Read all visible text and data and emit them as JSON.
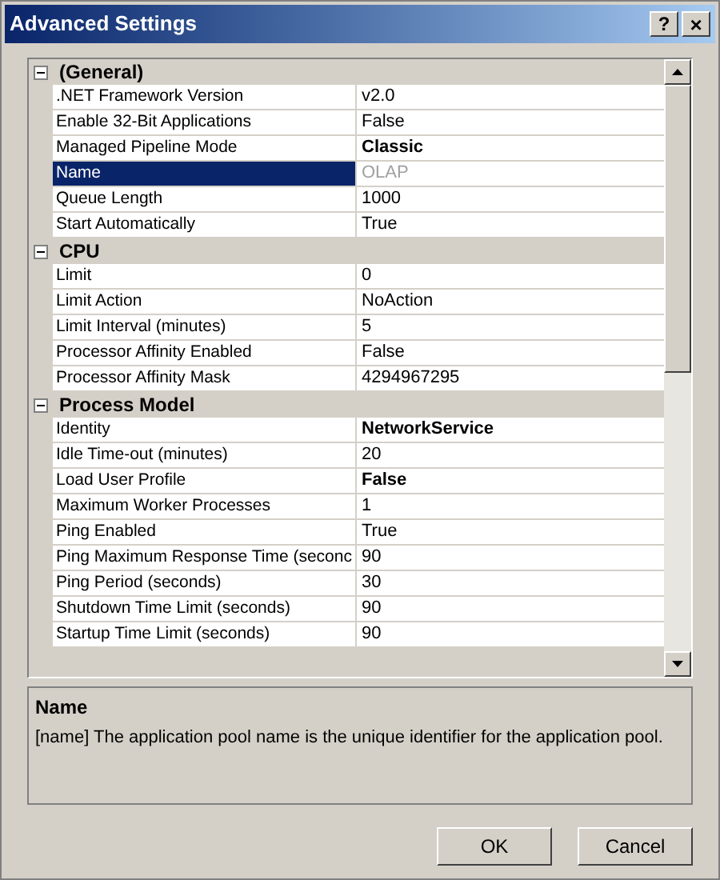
{
  "window": {
    "title": "Advanced Settings",
    "help_button": "?",
    "close_button": "×"
  },
  "groups": [
    {
      "name": "(General)",
      "expanded": true,
      "properties": [
        {
          "name": ".NET Framework Version",
          "value": "v2.0",
          "bold": false,
          "selected": false,
          "disabled": false
        },
        {
          "name": "Enable 32-Bit Applications",
          "value": "False",
          "bold": false,
          "selected": false,
          "disabled": false
        },
        {
          "name": "Managed Pipeline Mode",
          "value": "Classic",
          "bold": true,
          "selected": false,
          "disabled": false
        },
        {
          "name": "Name",
          "value": "OLAP",
          "bold": false,
          "selected": true,
          "disabled": true
        },
        {
          "name": "Queue Length",
          "value": "1000",
          "bold": false,
          "selected": false,
          "disabled": false
        },
        {
          "name": "Start Automatically",
          "value": "True",
          "bold": false,
          "selected": false,
          "disabled": false
        }
      ]
    },
    {
      "name": "CPU",
      "expanded": true,
      "properties": [
        {
          "name": "Limit",
          "value": "0",
          "bold": false,
          "selected": false,
          "disabled": false
        },
        {
          "name": "Limit Action",
          "value": "NoAction",
          "bold": false,
          "selected": false,
          "disabled": false
        },
        {
          "name": "Limit Interval (minutes)",
          "value": "5",
          "bold": false,
          "selected": false,
          "disabled": false
        },
        {
          "name": "Processor Affinity Enabled",
          "value": "False",
          "bold": false,
          "selected": false,
          "disabled": false
        },
        {
          "name": "Processor Affinity Mask",
          "value": "4294967295",
          "bold": false,
          "selected": false,
          "disabled": false
        }
      ]
    },
    {
      "name": "Process Model",
      "expanded": true,
      "properties": [
        {
          "name": "Identity",
          "value": "NetworkService",
          "bold": true,
          "selected": false,
          "disabled": false
        },
        {
          "name": "Idle Time-out (minutes)",
          "value": "20",
          "bold": false,
          "selected": false,
          "disabled": false
        },
        {
          "name": "Load User Profile",
          "value": "False",
          "bold": true,
          "selected": false,
          "disabled": false
        },
        {
          "name": "Maximum Worker Processes",
          "value": "1",
          "bold": false,
          "selected": false,
          "disabled": false
        },
        {
          "name": "Ping Enabled",
          "value": "True",
          "bold": false,
          "selected": false,
          "disabled": false
        },
        {
          "name": "Ping Maximum Response Time (seconc",
          "value": "90",
          "bold": false,
          "selected": false,
          "disabled": false
        },
        {
          "name": "Ping Period (seconds)",
          "value": "30",
          "bold": false,
          "selected": false,
          "disabled": false
        },
        {
          "name": "Shutdown Time Limit (seconds)",
          "value": "90",
          "bold": false,
          "selected": false,
          "disabled": false
        },
        {
          "name": "Startup Time Limit (seconds)",
          "value": "90",
          "bold": false,
          "selected": false,
          "disabled": false
        }
      ]
    }
  ],
  "description": {
    "title": "Name",
    "text": "[name] The application pool name is the unique identifier for the application pool."
  },
  "buttons": [
    "OK",
    "Cancel"
  ]
}
